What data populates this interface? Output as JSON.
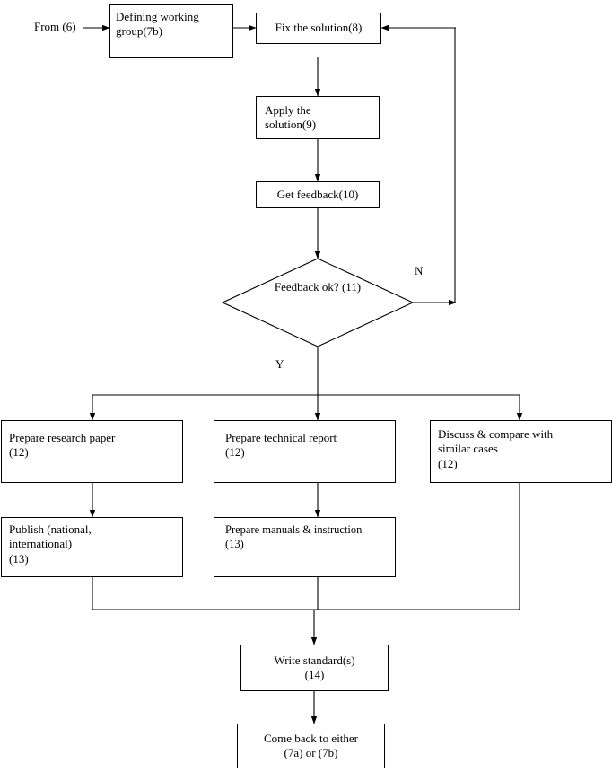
{
  "diagram": {
    "type": "flowchart",
    "title": "",
    "nodes": [
      {
        "id": "from",
        "label": "From  (6)"
      },
      {
        "id": "working",
        "label": "Defining working\ngroup(7b)"
      },
      {
        "id": "fix",
        "label": "Fix the solution(8)"
      },
      {
        "id": "apply",
        "label": "Apply the\nsolution(9)"
      },
      {
        "id": "feedback",
        "label": "Get feedback(10)"
      },
      {
        "id": "decision",
        "label": "Feedback ok?\n(11)"
      },
      {
        "id": "paper",
        "label": "Prepare research paper\n                (12)"
      },
      {
        "id": "report",
        "label": "Prepare technical report\n                (12)"
      },
      {
        "id": "discuss",
        "label": "Discuss & compare with\nsimilar cases\n                   (12)"
      },
      {
        "id": "publish",
        "label": "Publish (national,\ninternational)\n               (13)"
      },
      {
        "id": "manuals",
        "label": "Prepare manuals & instruction\n                     (13)"
      },
      {
        "id": "standard",
        "label": "Write standard(s)\n(14)"
      },
      {
        "id": "comeback",
        "label": "Come back to either\n(7a) or (7b)"
      }
    ],
    "edge_labels": [
      {
        "id": "no-label",
        "text": "N"
      },
      {
        "id": "yes-label",
        "text": "Y"
      }
    ],
    "colors": {
      "line": "#000000",
      "box_fill": "#ffffff",
      "text": "#000000"
    }
  }
}
